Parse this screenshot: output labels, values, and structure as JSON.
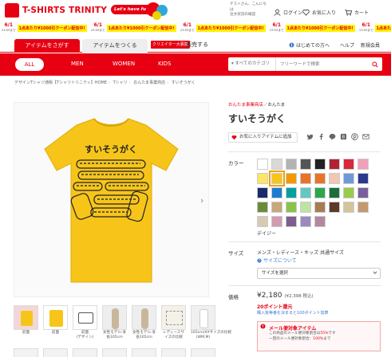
{
  "brand": {
    "logo_text": "T-SHIRTS TRINITY",
    "tagline": "Let's have fun!",
    "badge_text": "11"
  },
  "header": {
    "guest_text": "ゲストさん、こんにちは",
    "order_status": "注文状況の確認",
    "login": "ログイン",
    "favorites": "お気に入り",
    "cart": "カート"
  },
  "coupons": [
    {
      "date": "6/1",
      "time": "23:59まで",
      "text": "1点あたり¥1000引クーポン配信中!"
    },
    {
      "date": "6/1",
      "time": "23:59まで",
      "text": "1点あたり¥1000引クーポン配信中!"
    },
    {
      "date": "6/1",
      "time": "23:59まで",
      "text": "1点あたり¥1000引クーポン配信中!"
    },
    {
      "date": "6/1",
      "time": "23:59まで",
      "text": "1点あたり¥1000引クーポン配信中!"
    },
    {
      "date": "6/1",
      "time": "23:59まで",
      "text": "1点あたり¥1000引クーポン配信中!"
    }
  ],
  "tabs": {
    "search": "アイテムをさがす",
    "make": "アイテムをつくる",
    "creator_badge": "クリエイター大募集",
    "sell": "販売する"
  },
  "utility": {
    "beginner": "はじめての方へ",
    "help": "ヘルプ",
    "register": "新規会員"
  },
  "categories": {
    "all": "ALL",
    "men": "MEN",
    "women": "WOMEN",
    "kids": "KIDS"
  },
  "search": {
    "category": "すべてのカテゴリ",
    "placeholder": "フリーワードで検索"
  },
  "breadcrumb": [
    "デザインTシャツ通販【Tシャツトリニティ】HOME",
    "Tシャツ",
    "おんたま事業商店",
    "すいそうがく"
  ],
  "product": {
    "shop": "おんたま事業商店",
    "shop_sub": "／おんたま",
    "title": "すいそうがく",
    "fav_button": "お気に入りアイテムに追加",
    "print_title": "すいそうがく",
    "selected_color": "デイジー"
  },
  "thumbnails": [
    {
      "caption": "前面"
    },
    {
      "caption": "前面"
    },
    {
      "caption": "前面\n(デザイン)"
    },
    {
      "caption": "女性モデル:身長165cm"
    },
    {
      "caption": "女性モデル:身長165cm"
    },
    {
      "caption": "レディースサイズの比較"
    },
    {
      "caption": "165cm/XXサイズの比較\n(WM,M)"
    }
  ],
  "labels": {
    "color": "カラー",
    "size": "サイズ",
    "price": "価格"
  },
  "sizes": {
    "text": "メンズ・レディース・キッズ 共通サイズ",
    "about": "サイズについて",
    "select_placeholder": "サイズを選択"
  },
  "price": {
    "value": "¥2,180",
    "tax": "(¥2,398 税込)",
    "points": "20ポイント還元",
    "points_note": "購入後等番を決まると100ポイント加算"
  },
  "mail": {
    "title": "メール便対象アイテム",
    "line1_a": "この商品のメール便対象割合は",
    "line1_b": "55%",
    "line1_c": "です",
    "line2_a": "一回のメール便対象割合：",
    "line2_b": "100%",
    "line2_c": "まで"
  },
  "colors": {
    "accent": "#e60012",
    "shirt": "#f7c51a",
    "swatches": [
      "#ffffff",
      "#d9d9d9",
      "#b3b3b3",
      "#555555",
      "#222222",
      "#b22234",
      "#d8283a",
      "#f0a0b8",
      "#ffe567",
      "#f7c51a",
      "#f39800",
      "#e8742a",
      "#e8742a",
      "#f3c6b4",
      "#6e9bd7",
      "#2a3a8f",
      "#1b2a6b",
      "#1d7ccf",
      "#00a0a0",
      "#65c6c2",
      "#2ea74c",
      "#1a6e3a",
      "#9acb4a",
      "#7a5e9e",
      "#6a8b3c",
      "#c8a77a",
      "#8bc34a",
      "#bfe3a4",
      "#a67c52",
      "#5b3a26",
      "#d4c49c",
      "#c49a6c",
      "#d8c9b2",
      "#d39bb0",
      "#7d5e8f",
      "#9b8ac0",
      "#b4879f"
    ],
    "selected_index": 9
  }
}
